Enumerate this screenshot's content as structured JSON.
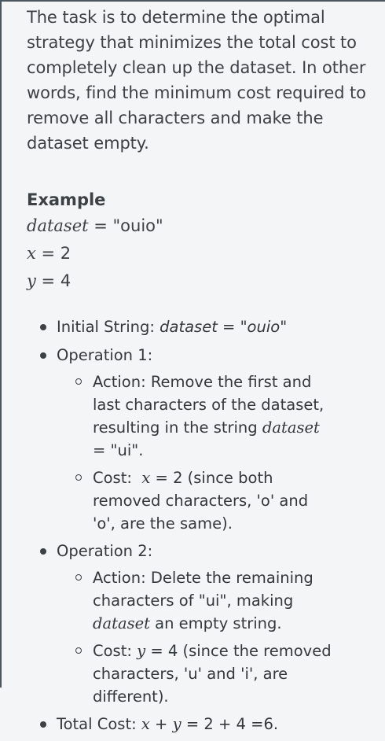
{
  "intro_text": "The task is to determine the optimal strategy that minimizes the total cost to completely clean up the dataset. In other words, find the minimum cost required to remove all characters and make the dataset empty.",
  "example": {
    "heading": "Example",
    "dataset_var": "dataset",
    "dataset_eq": " = \"ouio\"",
    "x_var": "x",
    "x_eq": " = 2",
    "y_var": "y",
    "y_eq": " = 4"
  },
  "steps": {
    "initial": {
      "prefix": "Initial String: ",
      "expr": "dataset = \"ouio\""
    },
    "op1": {
      "label": "Operation 1:",
      "action_text": "Action: Remove the first and last characters of the dataset, resulting in the string ",
      "action_var": "dataset",
      "action_end": " = \"ui\".",
      "cost_prefix": "Cost:  ",
      "cost_var": "x",
      "cost_text": " = 2 (since both removed characters, 'o' and 'o', are the same)."
    },
    "op2": {
      "label": "Operation 2:",
      "action_text": "Action: Delete the remaining characters of \"ui\", making ",
      "action_var": "dataset",
      "action_end": " an empty string.",
      "cost_prefix": "Cost: ",
      "cost_var": "y",
      "cost_text": " = 4 (since the removed characters, 'u' and 'i', are different)."
    },
    "total": {
      "prefix": "Total Cost: ",
      "x_var": "x",
      "plus": " + ",
      "y_var": "y",
      "rest": " = 2 + 4 =6."
    }
  }
}
